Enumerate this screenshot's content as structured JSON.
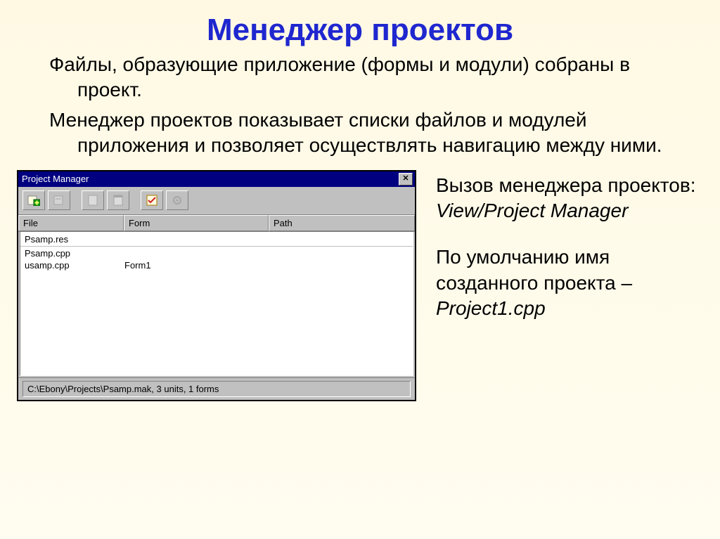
{
  "slide": {
    "title": "Менеджер проектов",
    "p1": "Файлы, образующие приложение (формы и модули) собраны в проект.",
    "p2": "Менеджер проектов показывает списки файлов и модулей приложения и позволяет осуществлять навигацию между ними."
  },
  "side": {
    "call_label": "Вызов менеджера проектов:",
    "call_path": "View/Project Manager",
    "default_label": "По умолчанию имя созданного проекта – ",
    "default_value": "Project1.cpp"
  },
  "win": {
    "title": "Project Manager",
    "columns": {
      "file": "File",
      "form": "Form",
      "path": "Path"
    },
    "rows": [
      {
        "file": "Psamp.res",
        "form": "",
        "path": ""
      },
      {
        "file": "Psamp.cpp",
        "form": "",
        "path": ""
      },
      {
        "file": "usamp.cpp",
        "form": "Form1",
        "path": ""
      }
    ],
    "status": "C:\\Ebony\\Projects\\Psamp.mak, 3 units, 1 forms"
  }
}
